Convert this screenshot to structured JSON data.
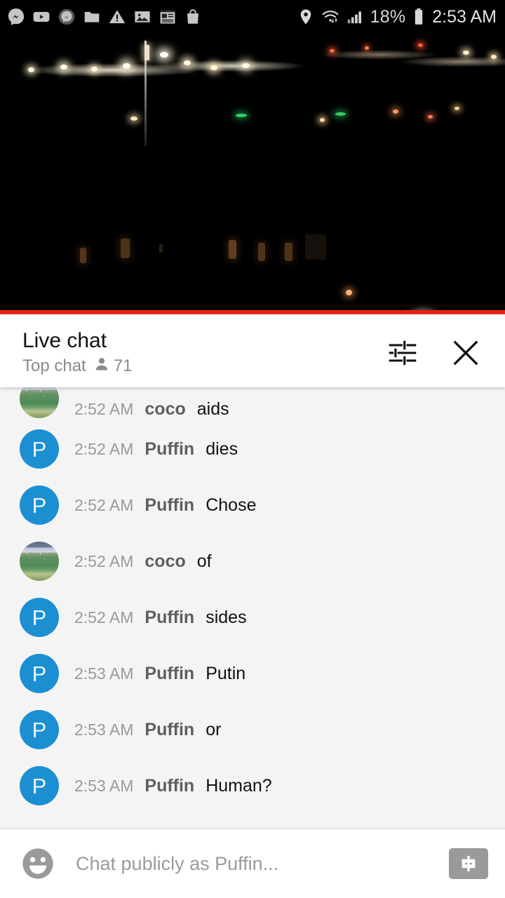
{
  "status_bar": {
    "left_icons": [
      {
        "name": "messenger-icon"
      },
      {
        "name": "youtube-icon"
      },
      {
        "name": "messenger-muted-icon"
      },
      {
        "name": "folder-icon"
      },
      {
        "name": "warning-icon"
      },
      {
        "name": "image-icon"
      },
      {
        "name": "news-icon"
      },
      {
        "name": "shopping-bag-icon"
      }
    ],
    "right_icons": [
      {
        "name": "location-icon"
      },
      {
        "name": "wifi-icon"
      },
      {
        "name": "signal-icon"
      }
    ],
    "battery_percent": "18%",
    "battery_icon": "battery-icon",
    "clock": "2:53 AM"
  },
  "video": {
    "name": "live-video-player",
    "description": "night cityscape"
  },
  "chat_header": {
    "title": "Live chat",
    "subtitle": "Top chat",
    "viewer_count": "71",
    "viewer_icon": "person-icon",
    "settings_icon": "tune-icon",
    "close_icon": "close-icon"
  },
  "messages": [
    {
      "avatar_type": "photo",
      "avatar_letter": "",
      "time": "2:52 AM",
      "author": "coco",
      "text": "aids",
      "partial": true
    },
    {
      "avatar_type": "letter",
      "avatar_letter": "P",
      "time": "2:52 AM",
      "author": "Puffin",
      "text": "dies",
      "partial": false
    },
    {
      "avatar_type": "letter",
      "avatar_letter": "P",
      "time": "2:52 AM",
      "author": "Puffin",
      "text": "Chose",
      "partial": false
    },
    {
      "avatar_type": "photo",
      "avatar_letter": "",
      "time": "2:52 AM",
      "author": "coco",
      "text": "of",
      "partial": false
    },
    {
      "avatar_type": "letter",
      "avatar_letter": "P",
      "time": "2:52 AM",
      "author": "Puffin",
      "text": "sides",
      "partial": false
    },
    {
      "avatar_type": "letter",
      "avatar_letter": "P",
      "time": "2:53 AM",
      "author": "Puffin",
      "text": "Putin",
      "partial": false
    },
    {
      "avatar_type": "letter",
      "avatar_letter": "P",
      "time": "2:53 AM",
      "author": "Puffin",
      "text": "or",
      "partial": false
    },
    {
      "avatar_type": "letter",
      "avatar_letter": "P",
      "time": "2:53 AM",
      "author": "Puffin",
      "text": "Human?",
      "partial": false
    }
  ],
  "input_bar": {
    "emoji_icon": "emoji-icon",
    "placeholder": "Chat publicly as Puffin...",
    "value": "",
    "superchat_icon": "dollar-icon"
  },
  "colors": {
    "accent_red": "#e62117",
    "avatar_blue": "#1b8fd2",
    "chat_bg": "#f4f4f4",
    "status_bg": "#000000"
  }
}
